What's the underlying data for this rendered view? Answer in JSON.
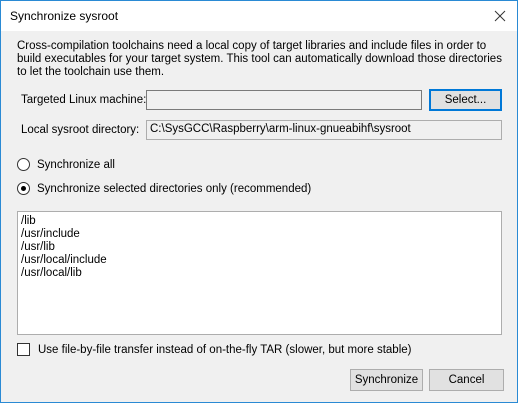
{
  "window": {
    "title": "Synchronize sysroot"
  },
  "intro": {
    "text": "Cross-compilation toolchains need a local copy of target libraries and include files in order to build executables for your target system. This tool can automatically download those directories to let the toolchain use them."
  },
  "target_machine": {
    "label": "Targeted Linux machine:",
    "value": "",
    "select_button": "Select..."
  },
  "sysroot": {
    "label": "Local sysroot directory:",
    "value": "C:\\SysGCC\\Raspberry\\arm-linux-gnueabihf\\sysroot"
  },
  "sync_options": {
    "all_label": "Synchronize all",
    "selected_label": "Synchronize selected directories only (recommended)",
    "selected": "selected"
  },
  "directories": [
    "/lib",
    "/usr/include",
    "/usr/lib",
    "/usr/local/include",
    "/usr/local/lib"
  ],
  "file_transfer": {
    "label": "Use file-by-file transfer instead of on-the-fly TAR (slower, but more stable)",
    "checked": false
  },
  "buttons": {
    "synchronize": "Synchronize",
    "cancel": "Cancel"
  },
  "icons": {
    "close": "close-icon"
  }
}
